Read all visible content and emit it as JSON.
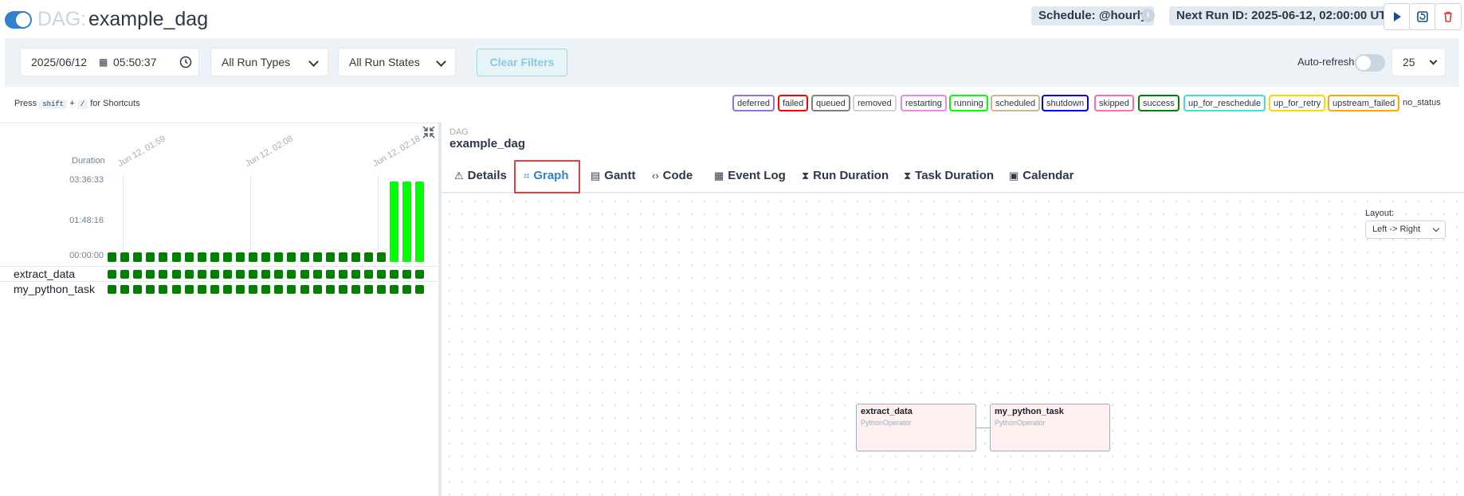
{
  "header": {
    "dag_prefix": "DAG:",
    "dag_id": "example_dag",
    "schedule": "Schedule: @hourly",
    "next_run": "Next Run ID: 2025-06-12, 02:00:00 UTC",
    "info_icon": "info-icon",
    "buttons": [
      {
        "name": "trigger-dag",
        "icon": "play-icon"
      },
      {
        "name": "clear-dag",
        "icon": "refresh-icon"
      },
      {
        "name": "delete-dag",
        "icon": "trash-icon"
      }
    ]
  },
  "filters": {
    "date": "2025/06/12",
    "time": "05:50:37",
    "run_types": "All Run Types",
    "run_states": "All Run States",
    "clear": "Clear Filters",
    "auto_refresh": "Auto-refresh",
    "num_runs": "25"
  },
  "shortcuts": {
    "prefix": "Press",
    "key1": "shift",
    "plus": "+",
    "key2": "/",
    "suffix": "for Shortcuts"
  },
  "legend": [
    {
      "label": "deferred",
      "color": "#9370db"
    },
    {
      "label": "failed",
      "color": "#ff0000"
    },
    {
      "label": "queued",
      "color": "#808080"
    },
    {
      "label": "removed",
      "color": "#d3d3d3"
    },
    {
      "label": "restarting",
      "color": "#ee82ee"
    },
    {
      "label": "running",
      "color": "#00ff00"
    },
    {
      "label": "scheduled",
      "color": "#d2b48c"
    },
    {
      "label": "shutdown",
      "color": "#0000ff"
    },
    {
      "label": "skipped",
      "color": "#ff69b4"
    },
    {
      "label": "success",
      "color": "#008000"
    },
    {
      "label": "up_for_reschedule",
      "color": "#40e0d0"
    },
    {
      "label": "up_for_retry",
      "color": "#ffd700"
    },
    {
      "label": "upstream_failed",
      "color": "#ffa500"
    },
    {
      "label": "no_status",
      "color": "#ffffff"
    }
  ],
  "grid": {
    "duration_label": "Duration",
    "y_ticks": [
      "03:36:33",
      "01:48:16",
      "00:00:00"
    ],
    "date_labels": [
      "Jun 12, 01:59",
      "Jun 12, 02:08",
      "Jun 12, 02:18"
    ],
    "tasks": [
      "extract_data",
      "my_python_task"
    ],
    "success_color": "#008000",
    "running_color": "#00ff00"
  },
  "chart_data": {
    "type": "bar",
    "ylabel": "Duration",
    "ylim": [
      "00:00:00",
      "03:36:33"
    ],
    "y_ticks": [
      "00:00:00",
      "01:48:16",
      "03:36:33"
    ],
    "x_tick_labels": [
      "Jun 12, 01:59",
      "Jun 12, 02:08",
      "Jun 12, 02:18"
    ],
    "run_count": 25,
    "series": [
      {
        "values": [
          0.02,
          0.02,
          0.02,
          0.02,
          0.02,
          0.02,
          0.02,
          0.02,
          0.02,
          0.02,
          0.02,
          0.02,
          0.02,
          0.02,
          0.02,
          0.02,
          0.02,
          0.02,
          0.02,
          0.02,
          0.02,
          0.02,
          1.0,
          1.0,
          1.0
        ],
        "states": [
          "success",
          "success",
          "success",
          "success",
          "success",
          "success",
          "success",
          "success",
          "success",
          "success",
          "success",
          "success",
          "success",
          "success",
          "success",
          "success",
          "success",
          "success",
          "success",
          "success",
          "success",
          "success",
          "running",
          "running",
          "running"
        ]
      }
    ]
  },
  "details": {
    "crumb_small": "DAG",
    "crumb_big": "example_dag",
    "tabs": [
      {
        "label": "Details",
        "icon": "warning-icon",
        "glyph": "⚠"
      },
      {
        "label": "Graph",
        "icon": "graph-icon",
        "glyph": "⌗"
      },
      {
        "label": "Gantt",
        "icon": "gantt-icon",
        "glyph": "▤"
      },
      {
        "label": "Code",
        "icon": "code-icon",
        "glyph": "‹›"
      },
      {
        "label": "Event Log",
        "icon": "log-icon",
        "glyph": "▦"
      },
      {
        "label": "Run Duration",
        "icon": "hourglass-icon",
        "glyph": "⧗"
      },
      {
        "label": "Task Duration",
        "icon": "hourglass-icon",
        "glyph": "⧗"
      },
      {
        "label": "Calendar",
        "icon": "calendar-icon",
        "glyph": "▣"
      }
    ],
    "active_tab": "Graph",
    "layout_label": "Layout:",
    "layout_value": "Left -> Right",
    "nodes": [
      {
        "name": "extract_data",
        "operator": "PythonOperator"
      },
      {
        "name": "my_python_task",
        "operator": "PythonOperator"
      }
    ]
  }
}
